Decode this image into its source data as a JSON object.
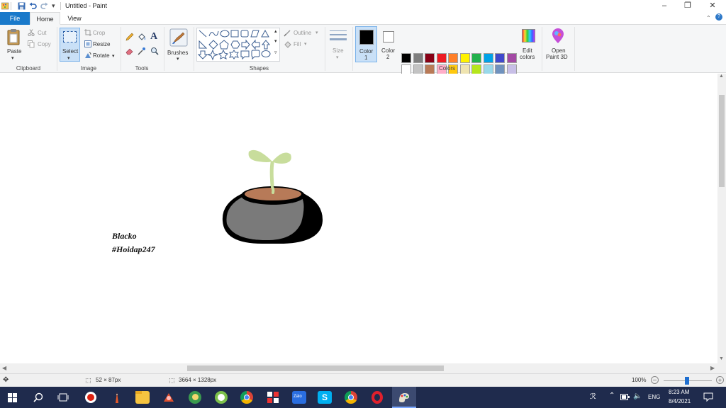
{
  "titlebar": {
    "title": "Untitled - Paint"
  },
  "tabs": {
    "file": "File",
    "home": "Home",
    "view": "View"
  },
  "clipboard": {
    "paste": "Paste",
    "cut": "Cut",
    "copy": "Copy",
    "label": "Clipboard"
  },
  "image": {
    "select": "Select",
    "crop": "Crop",
    "resize": "Resize",
    "rotate": "Rotate",
    "label": "Image"
  },
  "tools": {
    "label": "Tools",
    "text_glyph": "A"
  },
  "brushes": {
    "label": "Brushes"
  },
  "shapes": {
    "outline": "Outline",
    "fill": "Fill",
    "label": "Shapes"
  },
  "size": {
    "label": "Size"
  },
  "colors": {
    "color1": "Color",
    "color1_num": "1",
    "color2": "Color",
    "color2_num": "2",
    "edit_line1": "Edit",
    "edit_line2": "colors",
    "paint3d_line1": "Open",
    "paint3d_line2": "Paint 3D",
    "label": "Colors",
    "color1_value": "#000000",
    "color2_value": "#ffffff",
    "palette_row1": [
      "#000000",
      "#7f7f7f",
      "#880015",
      "#ed1c24",
      "#ff7f27",
      "#fff200",
      "#22b14c",
      "#00a2e8",
      "#3f48cc",
      "#a349a4"
    ],
    "palette_row2": [
      "#ffffff",
      "#c3c3c3",
      "#b97a57",
      "#ffaec9",
      "#ffc90e",
      "#efe4b0",
      "#b5e61d",
      "#99d9ea",
      "#7092be",
      "#c8bfe7"
    ],
    "palette_row3": [
      "#f7a86b",
      "#f9c3a6",
      "#f7a86b",
      "#c8d9a0",
      "#fff27a",
      "#ffffff",
      "#ffffff",
      "#ffffff",
      "#ffffff",
      "#ffffff"
    ]
  },
  "canvas": {
    "signature_line1": "Blacko",
    "signature_line2": "#Hoidap247"
  },
  "status": {
    "selection_size": "52 × 87px",
    "image_size": "3664 × 1328px",
    "zoom": "100%"
  },
  "taskbar": {
    "time": "8:23 AM",
    "date": "8/4/2021",
    "lang": "ENG"
  }
}
